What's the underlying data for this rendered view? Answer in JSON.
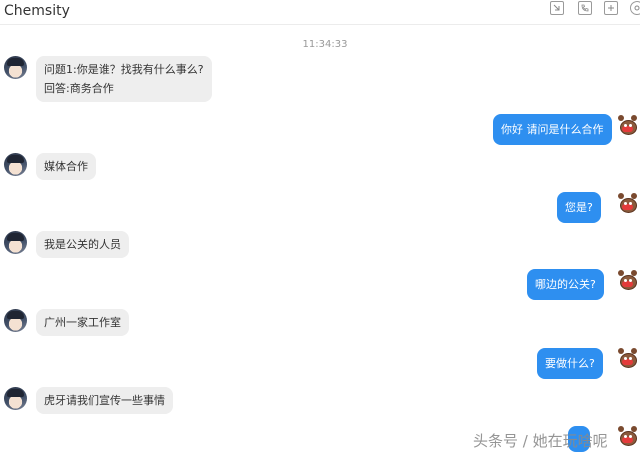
{
  "header": {
    "title": "Chemsity",
    "icons": [
      "minimize-window-icon",
      "phone-icon",
      "add-icon",
      "settings-icon"
    ]
  },
  "timestamp": "11:34:33",
  "messages": [
    {
      "from": "contact",
      "lines": [
        "问题1:你是谁？找我有什么事么?",
        "回答:商务合作"
      ]
    },
    {
      "from": "me",
      "text": "你好 请问是什么合作"
    },
    {
      "from": "contact",
      "text": "媒体合作"
    },
    {
      "from": "me",
      "text": "您是?"
    },
    {
      "from": "contact",
      "text": "我是公关的人员"
    },
    {
      "from": "me",
      "text": "哪边的公关?"
    },
    {
      "from": "contact",
      "text": "广州一家工作室"
    },
    {
      "from": "me",
      "text": "要做什么?"
    },
    {
      "from": "contact",
      "text": "虎牙请我们宣传一些事情"
    },
    {
      "from": "me",
      "text": ""
    }
  ],
  "watermark": "头条号 / 她在玩啥呢",
  "colors": {
    "outgoing_bubble": "#2e8ff0",
    "incoming_bubble": "#eeeeee"
  }
}
